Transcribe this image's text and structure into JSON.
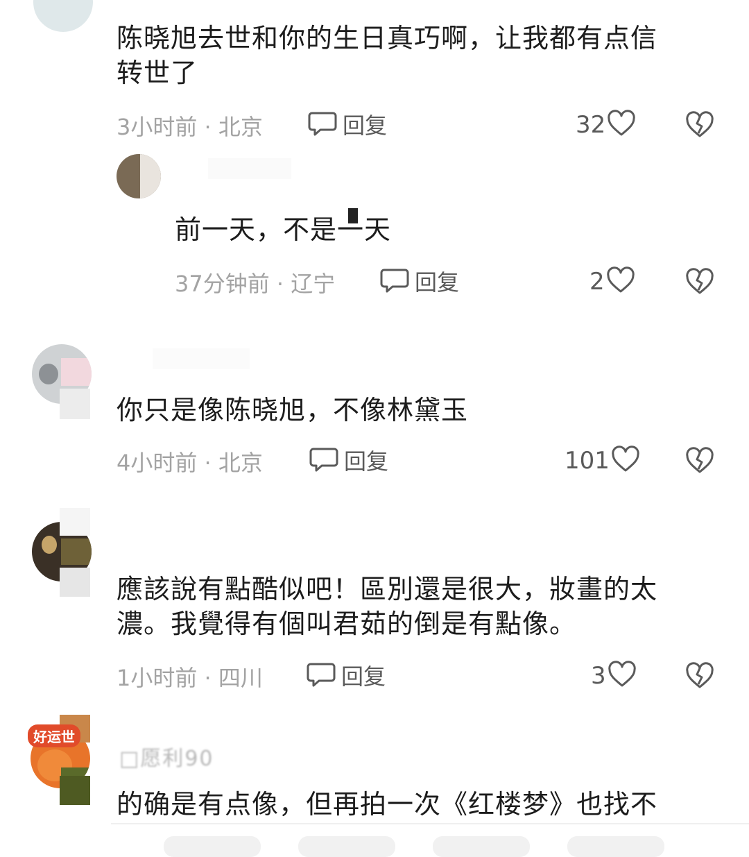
{
  "comments": [
    {
      "text": "陈晓旭去世和你的生日真巧啊，让我都有点信\n转世了",
      "meta": "3小时前 · 北京",
      "reply_label": "回复",
      "likes": "32",
      "reply": {
        "text": "前一天，不是一天",
        "meta": "37分钟前 · 辽宁",
        "reply_label": "回复",
        "likes": "2"
      }
    },
    {
      "text": "你只是像陈晓旭，不像林黛玉",
      "meta": "4小时前 · 北京",
      "reply_label": "回复",
      "likes": "101"
    },
    {
      "text": "應該說有點酷似吧！區別還是很大，妝畫的太\n濃。我覺得有個叫君茹的倒是有點像。",
      "meta": "1小时前 · 四川",
      "reply_label": "回复",
      "likes": "3"
    },
    {
      "username": "□愿利90",
      "badge": "好运世",
      "text": "的确是有点像，但再拍一次《红楼梦》也找不"
    }
  ],
  "colors": {
    "meta_text": "#a3a3a3",
    "action_text": "#5a5a5a",
    "body_text": "#1c1c1c"
  }
}
